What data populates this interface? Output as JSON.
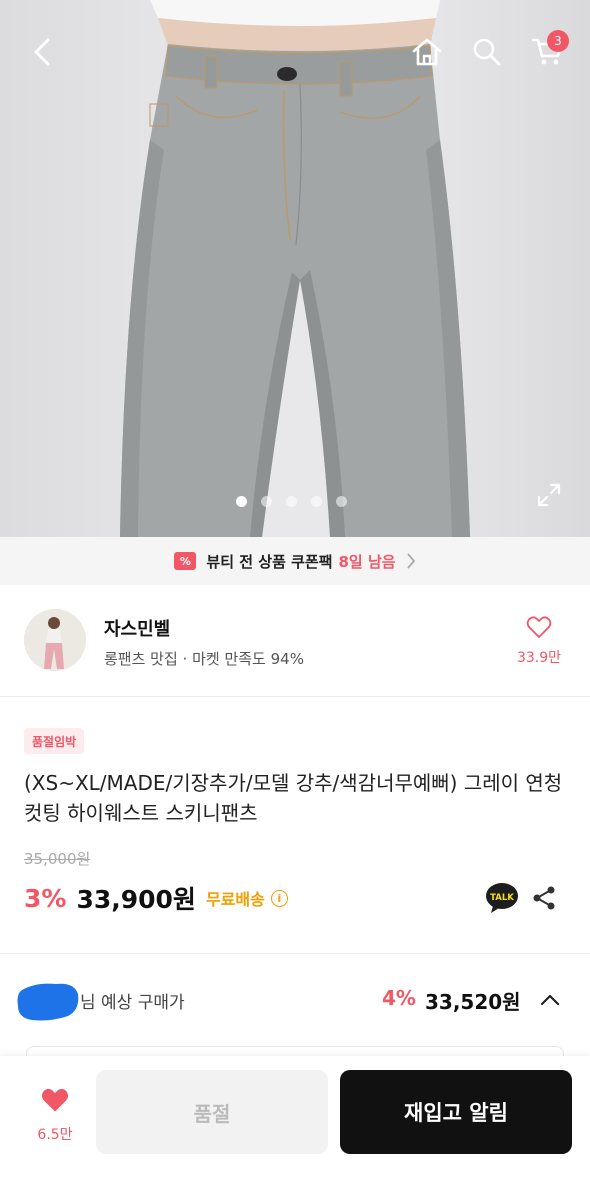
{
  "header": {
    "cart_count": "3",
    "icons": [
      "back-arrow-icon",
      "home-icon",
      "search-icon",
      "cart-icon",
      "expand-icon"
    ]
  },
  "gallery": {
    "total": 5,
    "active_index": 0
  },
  "coupon_banner": {
    "text": "뷰티 전 상품 쿠폰팩",
    "remaining": "8일 남음",
    "icon_text": "%"
  },
  "seller": {
    "name": "자스민벨",
    "description": "롱팬츠 맛집 · 마켓 만족도 94%",
    "likes": "33.9만"
  },
  "product": {
    "badge": "품절임박",
    "title": "(XS~XL/MADE/기장추가/모델 강추/색감너무예뻐) 그레이 연청 컷팅 하이웨스트 스키니팬츠",
    "original_price": "35,000원",
    "discount": "3%",
    "price": "33,900원",
    "shipping": "무료배송",
    "info_icon": "i",
    "talk_label": "TALK"
  },
  "expected": {
    "label": "님 예상 구매가",
    "discount": "4%",
    "price": "33,520원"
  },
  "bottom_bar": {
    "wish_count": "6.5만",
    "soldout_label": "품절",
    "restock_label": "재입고 알림"
  },
  "colors": {
    "accent": "#f25766",
    "shipping": "#f0a000",
    "primary_button": "#111111"
  }
}
